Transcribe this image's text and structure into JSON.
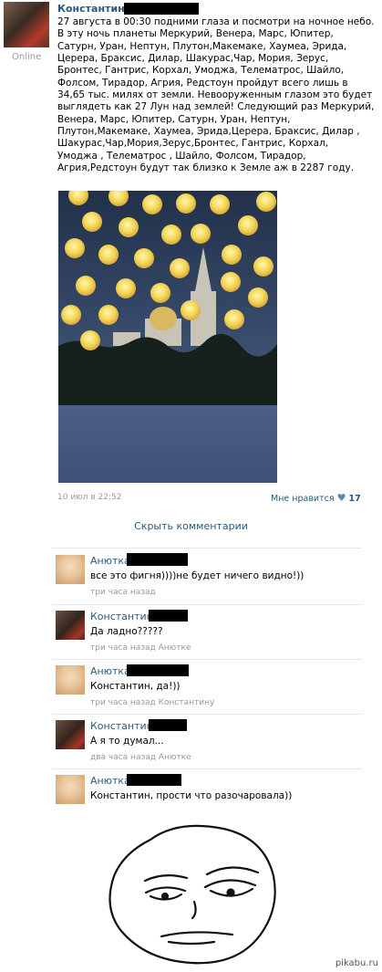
{
  "post": {
    "author": "Константин",
    "online": "Online",
    "text": "27 августа в 00:30 подними глаза и посмотри на ночное небо.\nВ эту ночь планеты Меркурий, Венера, Марс, Юпитер,\nСатурн, Уран, Нептун, Плутон,Макемаке, Хаумеа, Эрида,\nЦерера, Браксис, Дилар, Шакурас,Чар, Мория, Зерус,\nБронтес, Гантрис, Корхал, Умоджа, Телематрос, Шайло,\nФолсом, Тирадор, Агрия, Редстоун пройдут всего лишь в\n34,65 тыс. милях от земли. Невооруженным глазом это будет\nвыглядеть как 27 Лун над землей! Следующий раз Меркурий,\nВенера, Марс, Юпитер, Сатурн, Уран, Нептун,\nПлутон,Макемаке, Хаумеа, Эрида,Церера, Браксис, Дилар ,\nШакурас,Чар,Мория,Зерус,Бронтес, Гантрис, Корхал,\nУмоджа , Телематрос , Шайло, Фолсом, Тирадор,\nАгрия,Редстоун будут так близко к Земле аж в 2287 году.",
    "date": "10 июл в 22:52",
    "like_label": "Мне нравится",
    "like_count": "17",
    "collapse_label": "Скрыть комментарии"
  },
  "comments": [
    {
      "author": "Анютка",
      "text": "все это фигня))))не будет ничего видно!))",
      "meta": "три часа назад"
    },
    {
      "author": "Константин",
      "text": "Да ладно?????",
      "meta": "три часа назад Анютке"
    },
    {
      "author": "Анютка",
      "text": "Константин, да!))",
      "meta": "три часа назад Константину"
    },
    {
      "author": "Константин",
      "text": "А я то думал...",
      "meta": "два часа назад Анютке"
    },
    {
      "author": "Анютка",
      "text": "Константин, прости что разочаровала))",
      "meta": ""
    }
  ],
  "watermark": "pikabu.ru",
  "colors": {
    "link": "#2b587a",
    "meta": "#999999",
    "moon": "#f0d860",
    "sky": "#2d3f5c",
    "water": "#4a5a80"
  }
}
